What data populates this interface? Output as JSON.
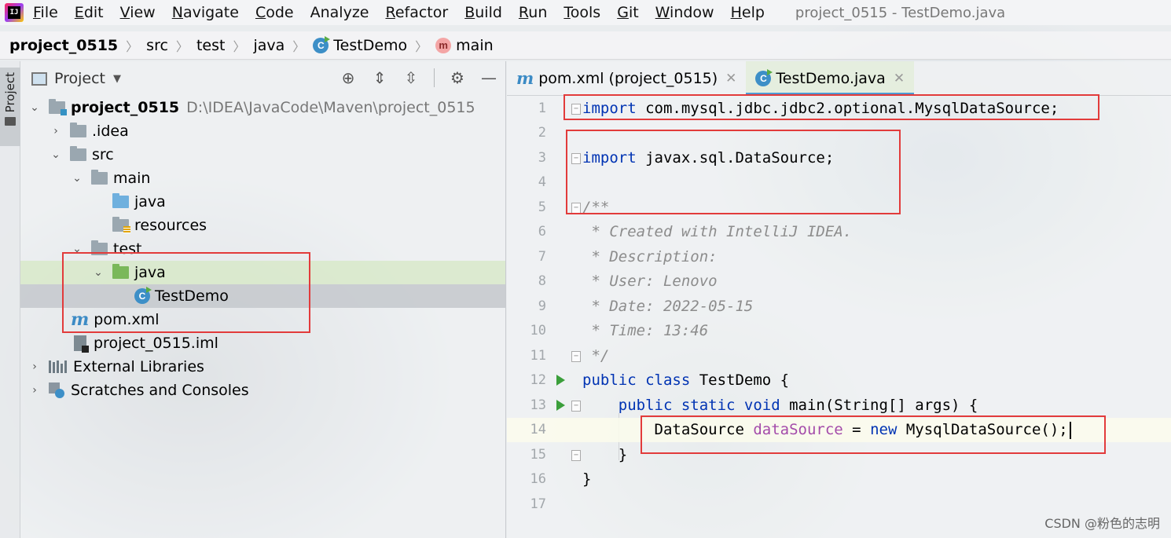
{
  "menubar": {
    "items": [
      {
        "mn": "F",
        "rest": "ile"
      },
      {
        "mn": "E",
        "rest": "dit"
      },
      {
        "mn": "V",
        "rest": "iew"
      },
      {
        "mn": "N",
        "rest": "avigate"
      },
      {
        "mn": "C",
        "rest": "ode"
      },
      {
        "mn": "",
        "rest": "Analyze"
      },
      {
        "mn": "R",
        "rest": "efactor"
      },
      {
        "mn": "B",
        "rest": "uild"
      },
      {
        "mn": "R",
        "rest": "un"
      },
      {
        "mn": "T",
        "rest": "ools"
      },
      {
        "mn": "G",
        "rest": "it"
      },
      {
        "mn": "W",
        "rest": "indow"
      },
      {
        "mn": "H",
        "rest": "elp"
      }
    ],
    "window_title": "project_0515 - TestDemo.java"
  },
  "breadcrumb": {
    "project": "project_0515",
    "src": "src",
    "test": "test",
    "java": "java",
    "cls": "TestDemo",
    "method": "main",
    "method_icon": "m"
  },
  "toolstripe": {
    "project_tab": "Project"
  },
  "project_panel": {
    "title": "Project",
    "tree": {
      "root_name": "project_0515",
      "root_path": "D:\\IDEA\\JavaCode\\Maven\\project_0515",
      "idea": ".idea",
      "src": "src",
      "main": "main",
      "main_java": "java",
      "resources": "resources",
      "test": "test",
      "test_java": "java",
      "testdemo": "TestDemo",
      "pom": "pom.xml",
      "iml": "project_0515.iml",
      "ext_libs": "External Libraries",
      "scratches": "Scratches and Consoles"
    }
  },
  "editor": {
    "tabs": [
      {
        "label": "pom.xml (project_0515)",
        "icon": "maven-icon"
      },
      {
        "label": "TestDemo.java",
        "icon": "class-icon"
      }
    ],
    "line_numbers": [
      "1",
      "2",
      "3",
      "4",
      "5",
      "6",
      "7",
      "8",
      "9",
      "10",
      "11",
      "12",
      "13",
      "14",
      "15",
      "16",
      "17"
    ],
    "code": {
      "l1_kw": "import",
      "l1_rest": " com.mysql.jdbc.jdbc2.optional.MysqlDataSource;",
      "l3_kw": "import",
      "l3_rest": " javax.sql.DataSource;",
      "l5": "/**",
      "l6": " * Created with IntelliJ IDEA.",
      "l7": " * Description:",
      "l8": " * User: Lenovo",
      "l9": " * Date: 2022-05-15",
      "l10": " * Time: 13:46",
      "l11": " */",
      "l12_kw": "public class",
      "l12_rest": " TestDemo {",
      "l13_kw": "    public static void",
      "l13_rest": " main(String[] args) {",
      "l14_a": "        DataSource ",
      "l14_var": "dataSource",
      "l14_b": " = ",
      "l14_kw": "new",
      "l14_c": " MysqlDataSource();",
      "l15": "    }",
      "l16": "}"
    }
  },
  "watermark": "CSDN @粉色的志明",
  "colors": {
    "highlight_box": "#e23b3b",
    "keyword": "#0033b3",
    "comment": "#8c8c8c"
  }
}
